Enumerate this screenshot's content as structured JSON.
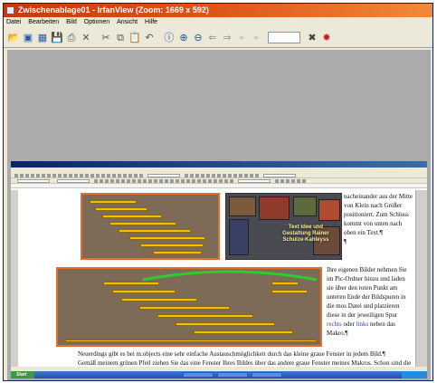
{
  "window": {
    "title": "Zwischenablage01 - IrfanView (Zoom: 1669 x 592)"
  },
  "menu": [
    "Datei",
    "Bearbeiten",
    "Bild",
    "Optionen",
    "Ansicht",
    "Hilfe"
  ],
  "toolbar": {
    "icons": [
      "open-icon",
      "slideshow-icon",
      "thumbnails-icon",
      "save-icon",
      "print-icon",
      "delete-icon",
      "cut-icon",
      "copy-icon",
      "paste-icon",
      "undo-icon",
      "info-icon",
      "zoom-in-icon",
      "zoom-out-icon",
      "prev-icon",
      "next-icon",
      "first-page-icon",
      "last-page-icon",
      "settings-icon",
      "irfanview-logo-icon"
    ],
    "zoom_value": ""
  },
  "collage": {
    "caption": "Text Idee und Gestaltung Rainer Schulze-Kahleyss"
  },
  "document": {
    "right_col_1": "nacheinander aus der Mitte von Klein nach Größer positioniert. Zum Schluss kommt von unten nach oben ein Text.¶",
    "pilcrow": "¶",
    "right_col_2_a": "Ihre eigenen Bilder nehmen Sie im Pic-Ordner hinzu und laden sie über den roten Punkt am unteren Ende der Bildspuren in die mos Datei und platzieren diese in der jeweiligen Spur ",
    "link_1": "rechts",
    "right_col_2_b": " oder ",
    "link_2": "links",
    "right_col_2_c": " neben das Makro.¶",
    "para_1": "Neuerdings gibt es bei m.objects eine sehr einfache Austauschmöglichkeit durch das kleine graue Fenster in jedem Bild.¶",
    "para_2": "Gemäß meinem grünen Pfeil ziehen Sie das eine Fenster Ihres Bildes über das andere graue Fenster meines Makros. Schon sind die Bilder ausgetauscht und Sie können das nun leere Bild, bzw. die leeren Bilder alle gleichzeitig per Gummiband markieren und mit Rechtsklick aus den"
  },
  "taskbar": {
    "start_label": "Start"
  },
  "colors": {
    "accent": "#e26f2c",
    "bar": "#f2c200",
    "link": "#2a48c8"
  }
}
